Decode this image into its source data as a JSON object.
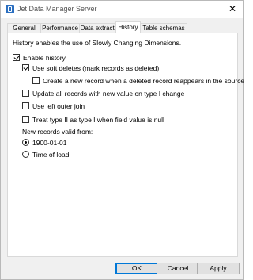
{
  "window": {
    "title": "Jet Data Manager Server"
  },
  "tabs": [
    {
      "label": "General"
    },
    {
      "label": "Performance"
    },
    {
      "label": "Data extraction"
    },
    {
      "label": "History"
    },
    {
      "label": "Table schemas"
    }
  ],
  "active_tab": "History",
  "panel": {
    "description": "History enables the use of Slowly Changing Dimensions.",
    "enable_history": {
      "label": "Enable history",
      "checked": true
    },
    "soft_deletes": {
      "label": "Use soft deletes (mark records as deleted)",
      "checked": true
    },
    "new_record_reappear": {
      "label": "Create a new record when a deleted record reappears in the source",
      "checked": false
    },
    "update_all_records": {
      "label": "Update all records with new value on type I change",
      "checked": false
    },
    "left_outer_join": {
      "label": "Use left outer join",
      "checked": false
    },
    "treat_type2_null": {
      "label": "Treat type II as type I when field value is null",
      "checked": false
    },
    "valid_from_heading": "New records valid from:",
    "valid_from_options": [
      {
        "label": "1900-01-01",
        "selected": true
      },
      {
        "label": "Time of load",
        "selected": false
      }
    ]
  },
  "buttons": {
    "ok": "OK",
    "cancel": "Cancel",
    "apply": "Apply"
  }
}
